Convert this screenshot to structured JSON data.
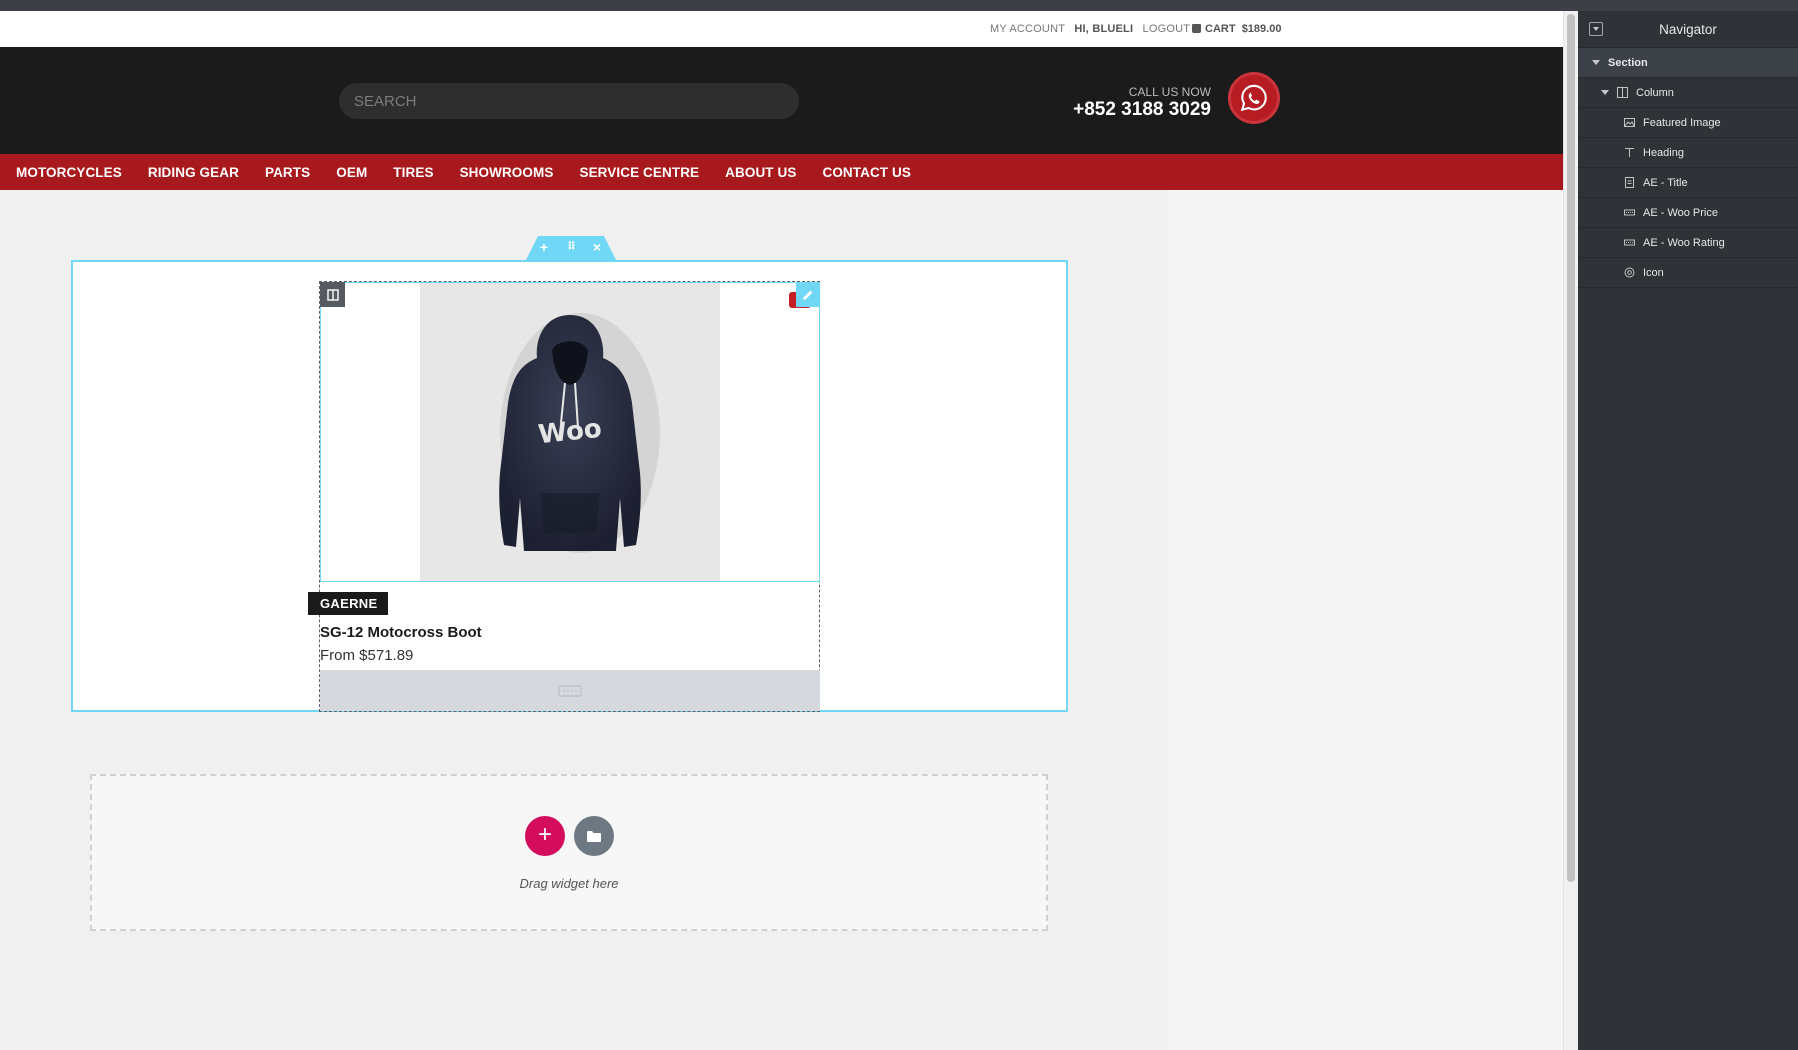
{
  "account": {
    "my_account": "MY ACCOUNT",
    "greeting": "HI, BLUELI",
    "logout": "LOGOUT",
    "cart_label": "CART",
    "cart_total": "$189.00"
  },
  "header": {
    "search_placeholder": "SEARCH",
    "call_label": "CALL US NOW",
    "call_number": "+852 3188 3029"
  },
  "nav": {
    "items": [
      "MOTORCYCLES",
      "RIDING GEAR",
      "PARTS",
      "OEM",
      "TIRES",
      "SHOWROOMS",
      "SERVICE CENTRE",
      "ABOUT US",
      "CONTACT US"
    ]
  },
  "product": {
    "brand": "GAERNE",
    "title": "SG-12 Motocross Boot",
    "price": "From $571.89",
    "image_text": "Woo"
  },
  "editor": {
    "drag_text": "Drag widget here"
  },
  "navigator": {
    "title": "Navigator",
    "items": [
      {
        "label": "Section",
        "icon": "caret-icon"
      },
      {
        "label": "Column",
        "icon": "column-icon"
      },
      {
        "label": "Featured Image",
        "icon": "image-icon"
      },
      {
        "label": "Heading",
        "icon": "heading-icon"
      },
      {
        "label": "AE - Title",
        "icon": "title-icon"
      },
      {
        "label": "AE - Woo Price",
        "icon": "price-icon"
      },
      {
        "label": "AE - Woo Rating",
        "icon": "rating-icon"
      },
      {
        "label": "Icon",
        "icon": "icon-icon"
      }
    ]
  },
  "colors": {
    "nav_red": "#a8191e",
    "editor_blue": "#71d7f7",
    "add_pink": "#d30c5c",
    "header_dark": "#1b1b1b",
    "panel_dark": "#2f3237"
  }
}
